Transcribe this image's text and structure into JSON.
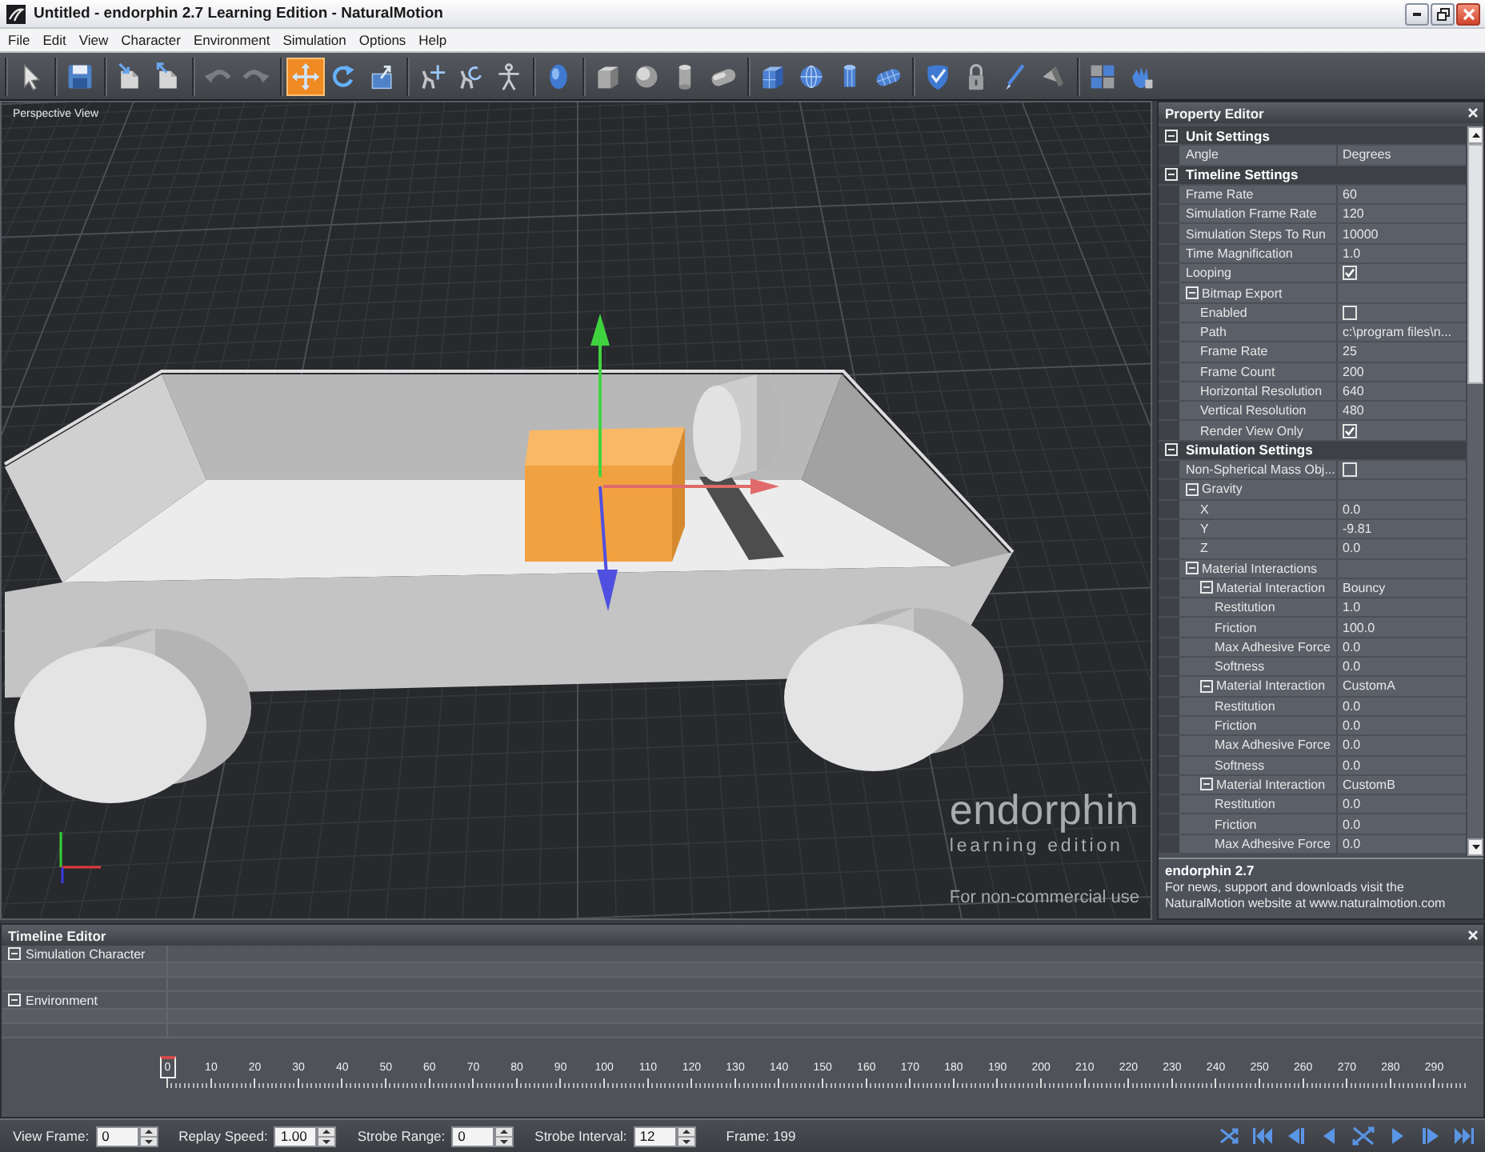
{
  "window": {
    "title": "Untitled - endorphin 2.7 Learning Edition - NaturalMotion"
  },
  "menu": [
    "File",
    "Edit",
    "View",
    "Character",
    "Environment",
    "Simulation",
    "Options",
    "Help"
  ],
  "toolbar": {
    "groups": [
      {
        "tools": [
          {
            "kind": "select",
            "selected": false,
            "disabled": false
          }
        ]
      },
      {
        "tools": [
          {
            "kind": "save",
            "selected": false,
            "disabled": false
          }
        ]
      },
      {
        "tools": [
          {
            "kind": "open",
            "selected": false,
            "disabled": false
          },
          {
            "kind": "import",
            "selected": false,
            "disabled": false
          }
        ]
      },
      {
        "tools": [
          {
            "kind": "undo",
            "selected": false,
            "disabled": true
          },
          {
            "kind": "redo",
            "selected": false,
            "disabled": true
          }
        ]
      },
      {
        "tools": [
          {
            "kind": "move",
            "selected": true,
            "disabled": false
          },
          {
            "kind": "rotate",
            "selected": false,
            "disabled": false
          },
          {
            "kind": "scale",
            "selected": false,
            "disabled": false
          }
        ]
      },
      {
        "tools": [
          {
            "kind": "pose_move",
            "selected": false,
            "disabled": false
          },
          {
            "kind": "pose_rotate",
            "selected": false,
            "disabled": false
          },
          {
            "kind": "figure",
            "selected": false,
            "disabled": false
          }
        ]
      },
      {
        "tools": [
          {
            "kind": "head",
            "selected": false,
            "disabled": false
          }
        ]
      },
      {
        "tools": [
          {
            "kind": "box",
            "selected": false,
            "disabled": false
          },
          {
            "kind": "sphere",
            "selected": false,
            "disabled": false
          },
          {
            "kind": "cylinder",
            "selected": false,
            "disabled": false
          },
          {
            "kind": "capsule",
            "selected": false,
            "disabled": false
          }
        ]
      },
      {
        "tools": [
          {
            "kind": "mesh_box",
            "selected": false,
            "disabled": false
          },
          {
            "kind": "mesh_sphere",
            "selected": false,
            "disabled": false
          },
          {
            "kind": "mesh_cylinder",
            "selected": false,
            "disabled": false
          },
          {
            "kind": "mesh_capsule",
            "selected": false,
            "disabled": false
          }
        ]
      },
      {
        "tools": [
          {
            "kind": "shield",
            "selected": false,
            "disabled": false
          },
          {
            "kind": "lock",
            "selected": false,
            "disabled": false
          },
          {
            "kind": "pen",
            "selected": false,
            "disabled": false
          },
          {
            "kind": "wedge",
            "selected": false,
            "disabled": false
          }
        ]
      },
      {
        "tools": [
          {
            "kind": "grid",
            "selected": false,
            "disabled": false
          },
          {
            "kind": "flame",
            "selected": false,
            "disabled": false
          }
        ]
      }
    ]
  },
  "viewport": {
    "title": "Perspective View",
    "logo": {
      "name": "endorphin",
      "edition": "learning edition",
      "notice": "For non-commercial use"
    }
  },
  "property_editor": {
    "title": "Property Editor",
    "sections": [
      {
        "label": "Unit Settings",
        "expanded": true,
        "children": [
          {
            "kind": "text",
            "label": "Angle",
            "value": "Degrees"
          }
        ]
      },
      {
        "label": "Timeline Settings",
        "expanded": true,
        "children": [
          {
            "kind": "text",
            "label": "Frame Rate",
            "value": "60"
          },
          {
            "kind": "text",
            "label": "Simulation Frame Rate",
            "value": "120"
          },
          {
            "kind": "text",
            "label": "Simulation Steps To Run",
            "value": "10000"
          },
          {
            "kind": "text",
            "label": "Time Magnification",
            "value": "1.0"
          },
          {
            "kind": "checkbox",
            "label": "Looping",
            "checked": true
          },
          {
            "kind": "group",
            "label": "Bitmap Export",
            "expanded": true,
            "children": [
              {
                "kind": "checkbox",
                "label": "Enabled",
                "checked": false
              },
              {
                "kind": "text",
                "label": "Path",
                "value": "c:\\program files\\n..."
              },
              {
                "kind": "text",
                "label": "Frame Rate",
                "value": "25"
              },
              {
                "kind": "text",
                "label": "Frame Count",
                "value": "200"
              },
              {
                "kind": "text",
                "label": "Horizontal Resolution",
                "value": "640"
              },
              {
                "kind": "text",
                "label": "Vertical Resolution",
                "value": "480"
              },
              {
                "kind": "checkbox",
                "label": "Render View Only",
                "checked": true
              }
            ]
          }
        ]
      },
      {
        "label": "Simulation Settings",
        "expanded": true,
        "children": [
          {
            "kind": "checkbox",
            "label": "Non-Spherical Mass Obj...",
            "checked": false
          },
          {
            "kind": "group",
            "label": "Gravity",
            "expanded": true,
            "children": [
              {
                "kind": "text",
                "label": "X",
                "value": "0.0"
              },
              {
                "kind": "text",
                "label": "Y",
                "value": "-9.81"
              },
              {
                "kind": "text",
                "label": "Z",
                "value": "0.0"
              }
            ]
          },
          {
            "kind": "group",
            "label": "Material Interactions",
            "expanded": true,
            "children": [
              {
                "kind": "group",
                "label": "Material Interaction",
                "value": "Bouncy",
                "expanded": true,
                "children": [
                  {
                    "kind": "text",
                    "label": "Restitution",
                    "value": "1.0"
                  },
                  {
                    "kind": "text",
                    "label": "Friction",
                    "value": "100.0"
                  },
                  {
                    "kind": "text",
                    "label": "Max Adhesive Force",
                    "value": "0.0"
                  },
                  {
                    "kind": "text",
                    "label": "Softness",
                    "value": "0.0"
                  }
                ]
              },
              {
                "kind": "group",
                "label": "Material Interaction",
                "value": "CustomA",
                "expanded": true,
                "children": [
                  {
                    "kind": "text",
                    "label": "Restitution",
                    "value": "0.0"
                  },
                  {
                    "kind": "text",
                    "label": "Friction",
                    "value": "0.0"
                  },
                  {
                    "kind": "text",
                    "label": "Max Adhesive Force",
                    "value": "0.0"
                  },
                  {
                    "kind": "text",
                    "label": "Softness",
                    "value": "0.0"
                  }
                ]
              },
              {
                "kind": "group",
                "label": "Material Interaction",
                "value": "CustomB",
                "expanded": true,
                "children": [
                  {
                    "kind": "text",
                    "label": "Restitution",
                    "value": "0.0"
                  },
                  {
                    "kind": "text",
                    "label": "Friction",
                    "value": "0.0"
                  },
                  {
                    "kind": "text",
                    "label": "Max Adhesive Force",
                    "value": "0.0"
                  }
                ]
              }
            ]
          }
        ]
      }
    ],
    "info": {
      "title": "endorphin 2.7",
      "text": "For news, support and downloads visit the NaturalMotion website at www.naturalmotion.com"
    }
  },
  "timeline_editor": {
    "title": "Timeline Editor",
    "tracks": [
      {
        "label": "Simulation Character",
        "expanded": true
      },
      {
        "label": "Environment",
        "expanded": true
      }
    ],
    "ruler": [
      {
        "label": "0",
        "selected": true
      },
      {
        "label": "10",
        "selected": false
      },
      {
        "label": "20",
        "selected": false
      },
      {
        "label": "30",
        "selected": false
      },
      {
        "label": "40",
        "selected": false
      },
      {
        "label": "50",
        "selected": false
      },
      {
        "label": "60",
        "selected": false
      },
      {
        "label": "70",
        "selected": false
      },
      {
        "label": "80",
        "selected": false
      },
      {
        "label": "90",
        "selected": false
      },
      {
        "label": "100",
        "selected": false
      },
      {
        "label": "110",
        "selected": false
      },
      {
        "label": "120",
        "selected": false
      },
      {
        "label": "130",
        "selected": false
      },
      {
        "label": "140",
        "selected": false
      },
      {
        "label": "150",
        "selected": false
      },
      {
        "label": "160",
        "selected": false
      },
      {
        "label": "170",
        "selected": false
      },
      {
        "label": "180",
        "selected": false
      },
      {
        "label": "190",
        "selected": false
      },
      {
        "label": "200",
        "selected": false
      },
      {
        "label": "210",
        "selected": false
      },
      {
        "label": "220",
        "selected": false
      },
      {
        "label": "230",
        "selected": false
      },
      {
        "label": "240",
        "selected": false
      },
      {
        "label": "250",
        "selected": false
      },
      {
        "label": "260",
        "selected": false
      },
      {
        "label": "270",
        "selected": false
      },
      {
        "label": "280",
        "selected": false
      },
      {
        "label": "290",
        "selected": false
      }
    ]
  },
  "controls": {
    "fields": [
      {
        "label": "View Frame:",
        "value": "0"
      },
      {
        "label": "Replay Speed:",
        "value": "1.00"
      },
      {
        "label": "Strobe Range:",
        "value": "0"
      },
      {
        "label": "Strobe Interval:",
        "value": "12"
      }
    ],
    "frame": "Frame: 199"
  }
}
